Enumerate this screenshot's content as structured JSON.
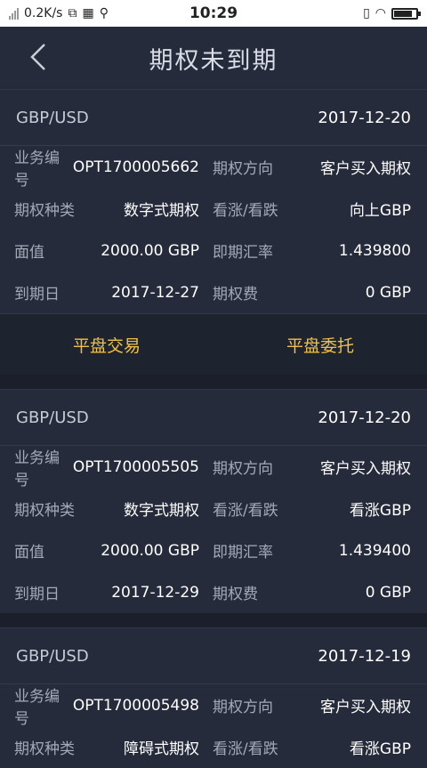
{
  "status": {
    "speed": "0.2K/s",
    "time": "10:29"
  },
  "header": {
    "title": "期权未到期"
  },
  "labels": {
    "biz_no": "业务编号",
    "direction": "期权方向",
    "type": "期权种类",
    "updown": "看涨/看跌",
    "face": "面值",
    "rate": "即期汇率",
    "expiry": "到期日",
    "fee": "期权费"
  },
  "cards": [
    {
      "pair": "GBP/USD",
      "date": "2017-12-20",
      "biz_no": "OPT1700005662",
      "direction": "客户买入期权",
      "type": "数字式期权",
      "updown": "向上GBP",
      "face": "2000.00 GBP",
      "rate": "1.439800",
      "expiry": "2017-12-27",
      "fee": "0 GBP",
      "actions": [
        "平盘交易",
        "平盘委托"
      ]
    },
    {
      "pair": "GBP/USD",
      "date": "2017-12-20",
      "biz_no": "OPT1700005505",
      "direction": "客户买入期权",
      "type": "数字式期权",
      "updown": "看涨GBP",
      "face": "2000.00 GBP",
      "rate": "1.439400",
      "expiry": "2017-12-29",
      "fee": "0 GBP"
    },
    {
      "pair": "GBP/USD",
      "date": "2017-12-19",
      "biz_no": "OPT1700005498",
      "direction": "客户买入期权",
      "type": "障碍式期权",
      "updown": "看涨GBP"
    }
  ],
  "colors": {
    "accent": "#f0c244",
    "background": "#1a1f2b",
    "card": "#252b3b"
  }
}
